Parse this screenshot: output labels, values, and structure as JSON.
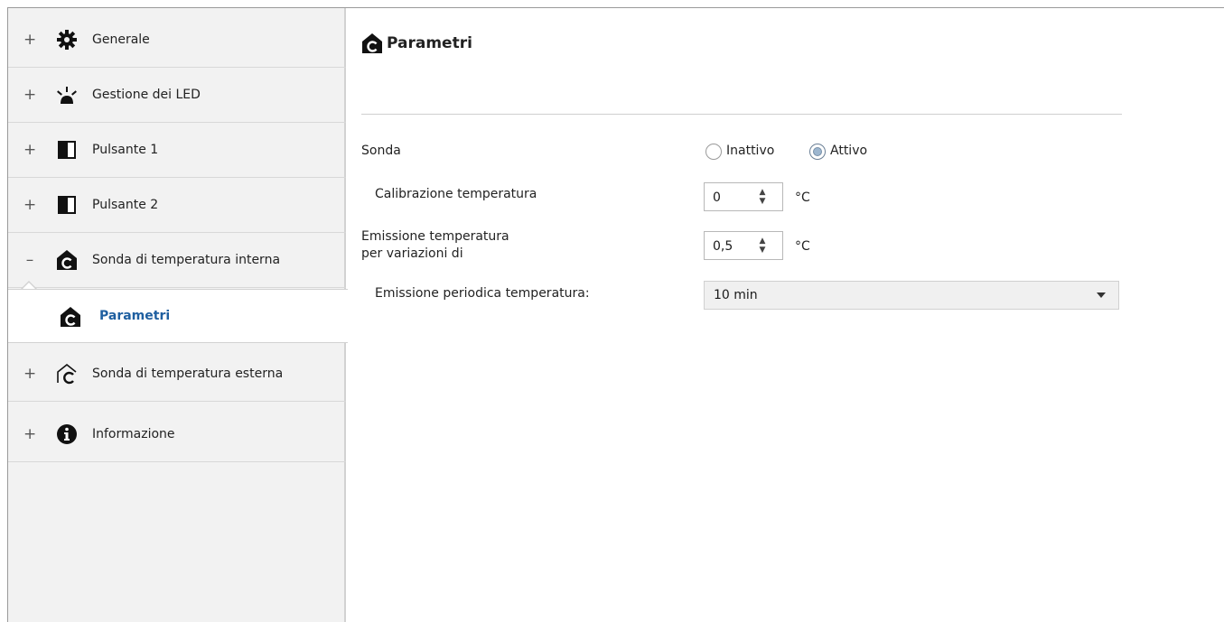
{
  "sidebar": {
    "items": [
      {
        "expander": "+",
        "label": "Generale"
      },
      {
        "expander": "+",
        "label": "Gestione dei LED"
      },
      {
        "expander": "+",
        "label": "Pulsante 1"
      },
      {
        "expander": "+",
        "label": "Pulsante 2"
      },
      {
        "expander": "–",
        "label": "Sonda di temperatura interna"
      },
      {
        "expander": "+",
        "label": "Sonda di temperatura esterna"
      },
      {
        "expander": "+",
        "label": "Informazione"
      }
    ],
    "subitem": {
      "label": "Parametri"
    }
  },
  "main": {
    "title": "Parametri",
    "sonda": {
      "label": "Sonda",
      "options": [
        "Inattivo",
        "Attivo"
      ],
      "selected": "Attivo"
    },
    "calibrazione": {
      "label": "Calibrazione temperatura",
      "value": "0",
      "unit": "°C"
    },
    "emissione_variazioni": {
      "label_line1": "Emissione temperatura",
      "label_line2": "per variazioni di",
      "value": "0,5",
      "unit": "°C"
    },
    "emissione_periodica": {
      "label": "Emissione periodica temperatura:",
      "value": "10 min"
    }
  },
  "colors": {
    "sidebar_bg": "#f2f2f2",
    "selected_text": "#1f5fa0",
    "select_bg": "#f0f0f0"
  },
  "icons": [
    "gear-icon",
    "led-icon",
    "button-icon",
    "thermometer-house-icon",
    "thermometer-house-outline-icon",
    "info-icon"
  ]
}
